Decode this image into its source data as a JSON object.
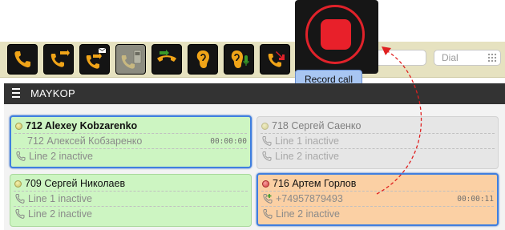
{
  "toolbar": {
    "buttons": [
      {
        "icon": "phone-handset-icon"
      },
      {
        "icon": "call-forward-icon"
      },
      {
        "icon": "voicemail-forward-icon"
      },
      {
        "icon": "conference-phone-icon"
      },
      {
        "icon": "call-transfer-icon"
      },
      {
        "icon": "listen-ear-icon"
      },
      {
        "icon": "whisper-ear-icon"
      },
      {
        "icon": "hangup-icon"
      }
    ],
    "record": {
      "icon": "record-icon",
      "tooltip": "Record call",
      "color": "#e8202a"
    },
    "dial_placeholder": "Dial"
  },
  "group": {
    "title": "MAYKOP"
  },
  "agents": [
    {
      "name": "712 Alexey Kobzarenko",
      "subtitle": "712 Алексей Кобзаренко",
      "time": "00:00:00",
      "line2": "Line 2 inactive",
      "state": "available",
      "color": "#cdf5c2",
      "selected": true
    },
    {
      "name": "718 Сергей Саенко",
      "line1": "Line 1 inactive",
      "line2": "Line 2 inactive",
      "state": "offline",
      "color": "#e6e6e6"
    },
    {
      "name": "709 Сергей Николаев",
      "line1": "Line 1 inactive",
      "line2": "Line 2 inactive",
      "state": "available",
      "color": "#cdf5c2"
    },
    {
      "name": "716 Артем Горлов",
      "active_call": "+74957879493",
      "time": "00:00:11",
      "line2": "Line 2 inactive",
      "state": "busy",
      "color": "#fbd0a4",
      "selected": true
    }
  ]
}
